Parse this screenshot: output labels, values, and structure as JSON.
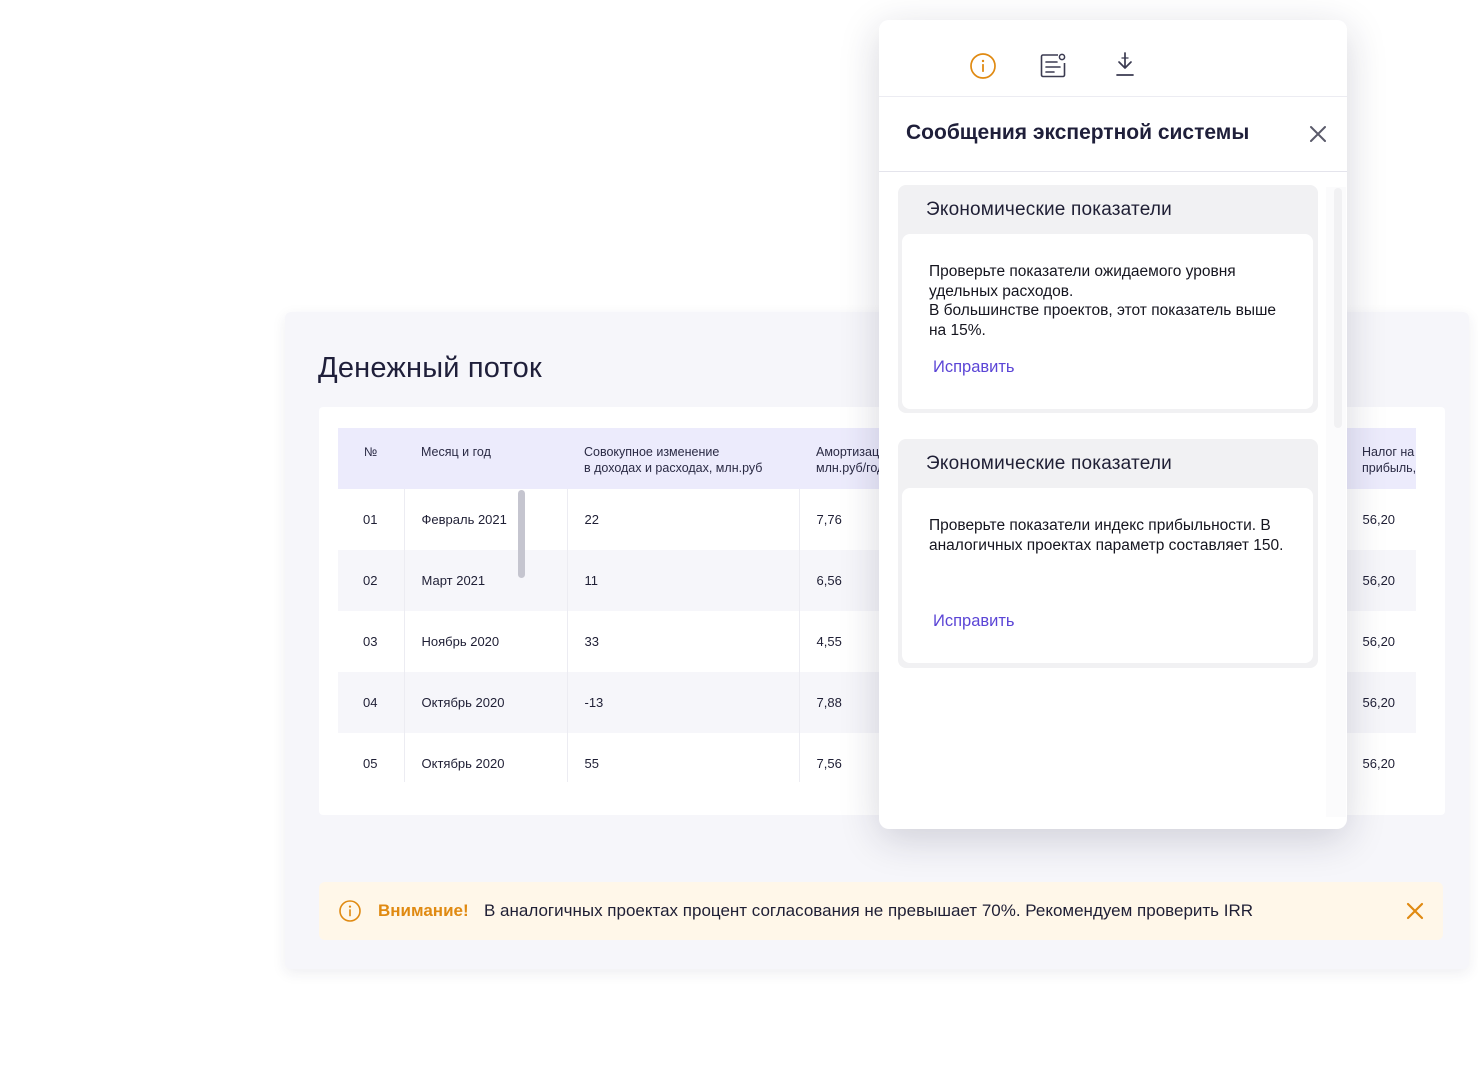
{
  "cash_flow": {
    "title": "Денежный поток",
    "columns": [
      "№",
      "Месяц и год",
      "Совокупное изменение\nв доходах и расходах, млн.руб",
      "Амортизация,\nмлн.руб/год",
      "",
      "",
      "Налог на\nприбыль, млн.руб"
    ],
    "rows": [
      [
        "01",
        "Февраль 2021",
        "22",
        "7,76",
        "",
        "",
        "56,20"
      ],
      [
        "02",
        "Март 2021",
        "11",
        "6,56",
        "",
        "",
        "56,20"
      ],
      [
        "03",
        "Ноябрь 2020",
        "33",
        "4,55",
        "",
        "",
        "56,20"
      ],
      [
        "04",
        "Октябрь 2020",
        "-13",
        "7,88",
        "",
        "",
        "56,20"
      ],
      [
        "05",
        "Октябрь 2020",
        "55",
        "7,56",
        "",
        "",
        "56,20"
      ]
    ]
  },
  "warning": {
    "title": "Внимание!",
    "text": "В аналогичных проектах процент согласования не превышает 70%. Рекомендуем проверить  IRR"
  },
  "panel": {
    "toolbar": [
      "info-icon",
      "settings-list-icon",
      "download-icon"
    ],
    "title": "Сообщения экспертной системы",
    "messages": [
      {
        "title": "Экономические показатели",
        "text": "Проверьте показатели ожидаемого уровня удельных расходов.\nВ большинстве проектов, этот показатель выше на 15%.",
        "action": "Исправить"
      },
      {
        "title": "Экономические показатели",
        "text": "Проверьте показатели индекс прибыльности. В аналогичных проектах параметр составляет 150.",
        "action": "Исправить"
      }
    ]
  },
  "colors": {
    "accent": "#5b45d6",
    "warning": "#e08a12",
    "header_bg": "#ecebfc"
  }
}
